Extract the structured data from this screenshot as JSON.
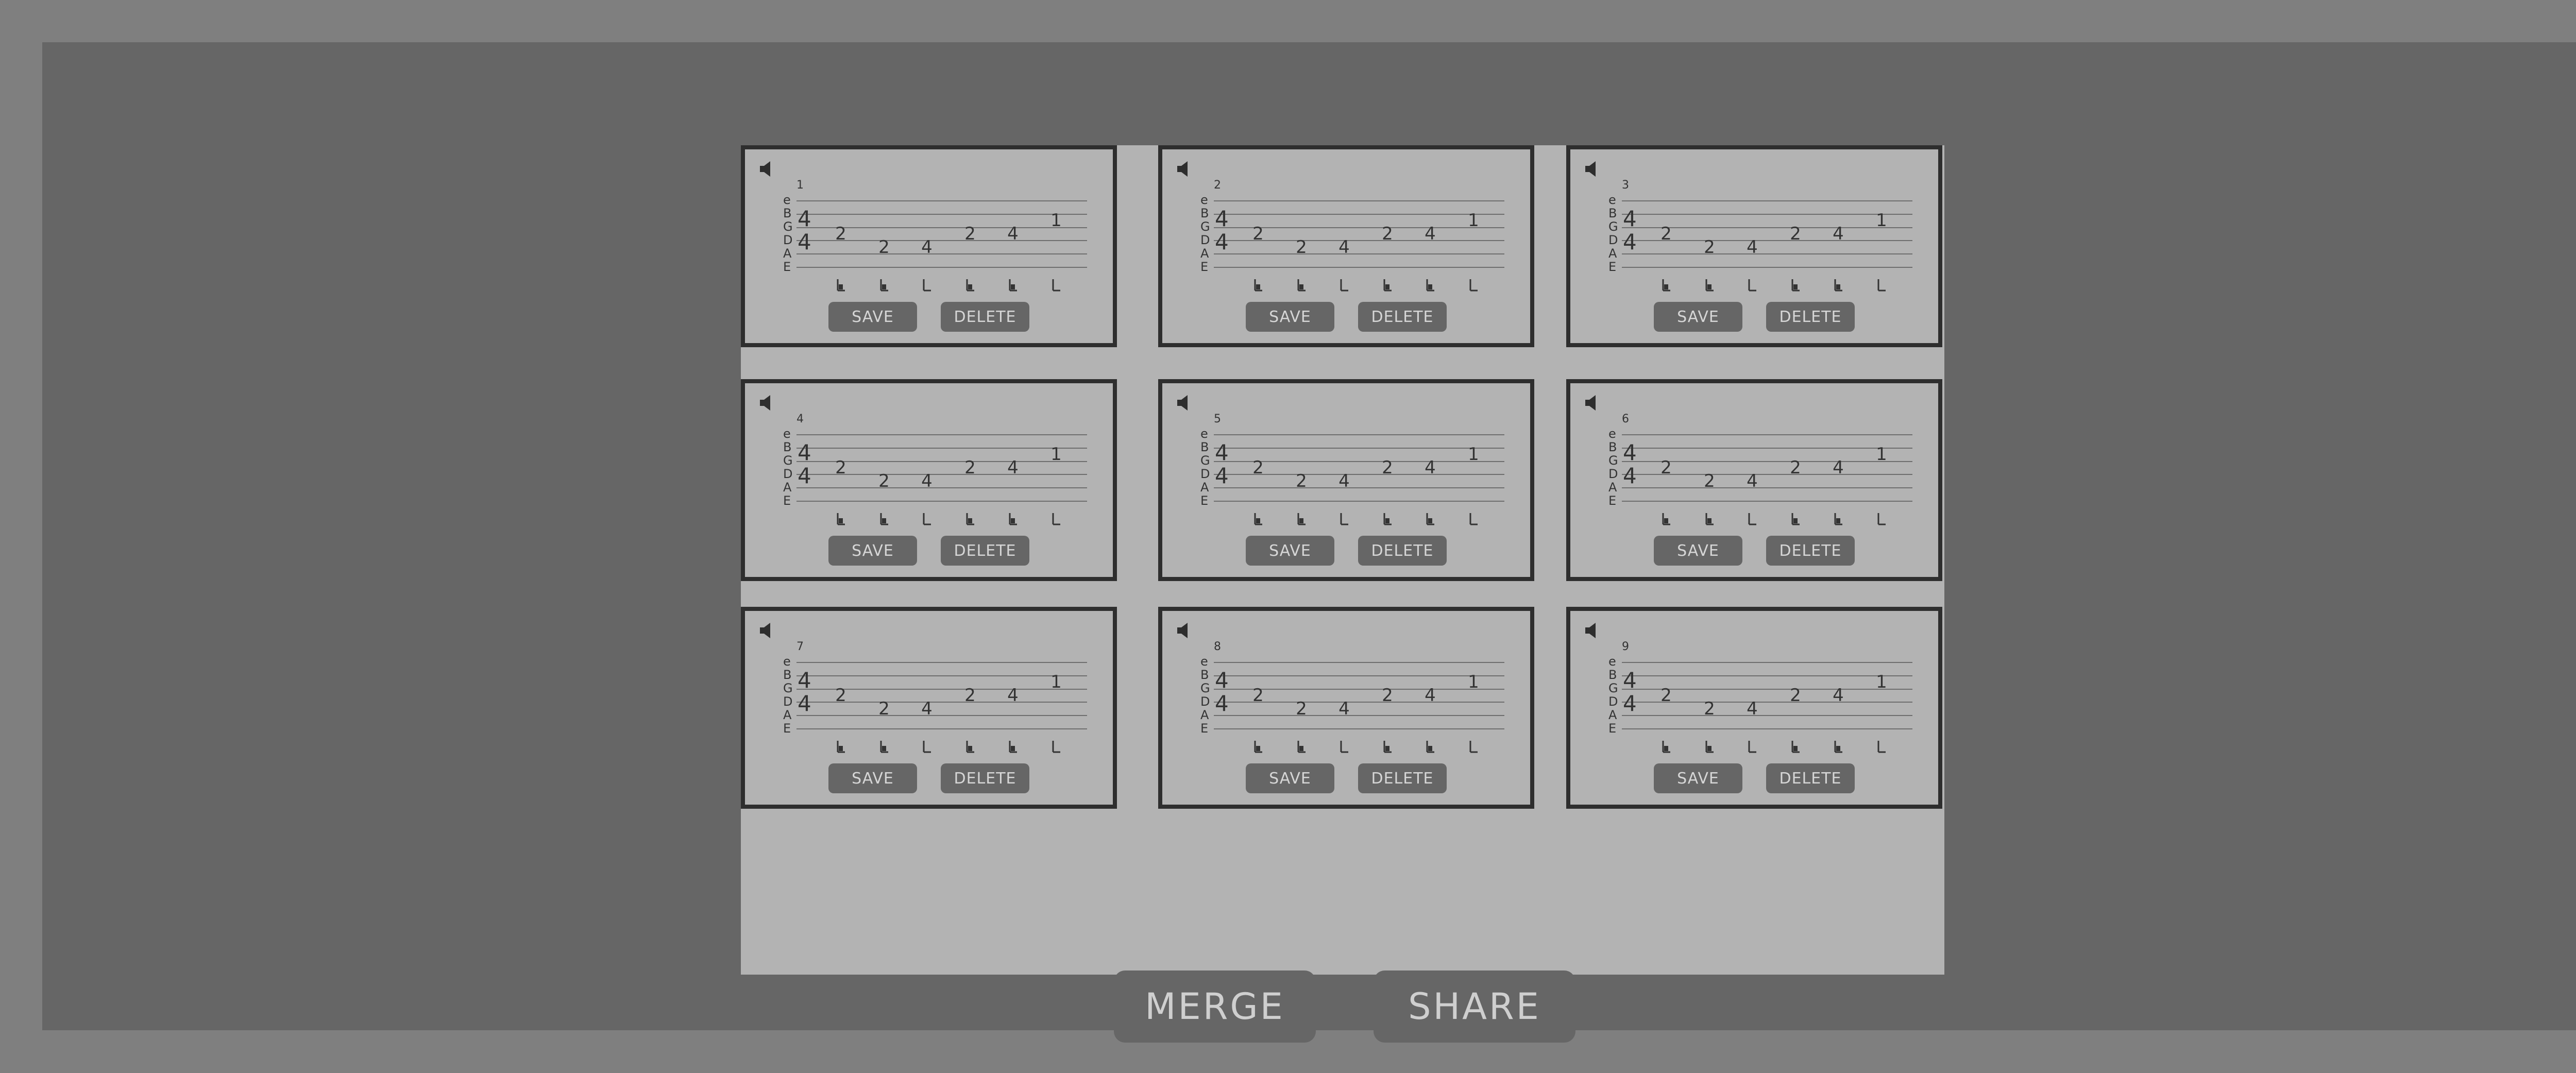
{
  "colors": {
    "outer": "#7f7f7f",
    "frame": "#666666",
    "panel": "#b3b3b3",
    "card_border": "#2e2e2e",
    "button": "#666666",
    "button_text": "#d6d6d6",
    "ink": "#333333"
  },
  "tab": {
    "strings": [
      "e",
      "B",
      "G",
      "D",
      "A",
      "E"
    ],
    "time_signature": [
      "4",
      "4"
    ],
    "notes": [
      "2",
      "2",
      "4",
      "2",
      "4",
      "1"
    ]
  },
  "cards": [
    {
      "number": "1",
      "save_label": "SAVE",
      "delete_label": "DELETE",
      "icon": "speaker-icon"
    },
    {
      "number": "2",
      "save_label": "SAVE",
      "delete_label": "DELETE",
      "icon": "speaker-icon"
    },
    {
      "number": "3",
      "save_label": "SAVE",
      "delete_label": "DELETE",
      "icon": "speaker-icon"
    },
    {
      "number": "4",
      "save_label": "SAVE",
      "delete_label": "DELETE",
      "icon": "speaker-icon"
    },
    {
      "number": "5",
      "save_label": "SAVE",
      "delete_label": "DELETE",
      "icon": "speaker-icon"
    },
    {
      "number": "6",
      "save_label": "SAVE",
      "delete_label": "DELETE",
      "icon": "speaker-icon"
    },
    {
      "number": "7",
      "save_label": "SAVE",
      "delete_label": "DELETE",
      "icon": "speaker-icon"
    },
    {
      "number": "8",
      "save_label": "SAVE",
      "delete_label": "DELETE",
      "icon": "speaker-icon"
    },
    {
      "number": "9",
      "save_label": "SAVE",
      "delete_label": "DELETE",
      "icon": "speaker-icon"
    }
  ],
  "actions": {
    "merge_label": "MERGE",
    "share_label": "SHARE"
  }
}
